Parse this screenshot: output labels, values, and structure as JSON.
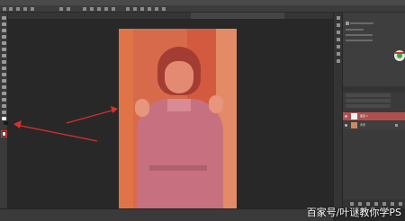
{
  "menubar": {
    "items": [
      "",
      "",
      "",
      "",
      "",
      "",
      "",
      "",
      "",
      "",
      ""
    ]
  },
  "document": {
    "tab_title": ""
  },
  "layers_panel": {
    "tabs": [
      "",
      "",
      ""
    ],
    "layers": [
      {
        "name": "图层 1",
        "selected": true
      },
      {
        "name": "背景",
        "selected": false
      }
    ]
  },
  "watermark": "百家号/叶谜教你学PS",
  "colors": {
    "annotation_red": "#d8312a",
    "overlay": "#e06440",
    "selected_layer": "#b0504e"
  },
  "icons": [
    "move-tool-icon",
    "marquee-tool-icon",
    "lasso-tool-icon",
    "quick-mask-icon",
    "eye-icon",
    "lock-icon"
  ]
}
